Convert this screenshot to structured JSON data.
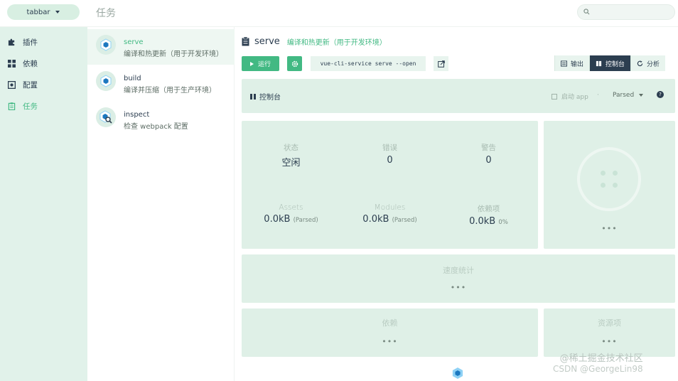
{
  "header": {
    "project_name": "tabbar",
    "page_title": "任务",
    "search_placeholder": ""
  },
  "sidebar": {
    "items": [
      {
        "label": "插件",
        "icon": "puzzle-icon",
        "active": false
      },
      {
        "label": "依赖",
        "icon": "grid-icon",
        "active": false
      },
      {
        "label": "配置",
        "icon": "settings-box-icon",
        "active": false
      },
      {
        "label": "任务",
        "icon": "clipboard-icon",
        "active": true
      }
    ]
  },
  "tasks": [
    {
      "name": "serve",
      "description": "编译和热更新（用于开发环境）",
      "icon": "webpack-cube-icon",
      "active": true
    },
    {
      "name": "build",
      "description": "编译并压缩（用于生产环境）",
      "icon": "webpack-cube-icon",
      "active": false
    },
    {
      "name": "inspect",
      "description": "检查 webpack 配置",
      "icon": "webpack-inspect-icon",
      "active": false
    }
  ],
  "task_detail": {
    "name": "serve",
    "description": "编译和热更新（用于开发环境）",
    "run_label": "运行",
    "command": "vue-cli-service serve --open",
    "view_tabs": [
      {
        "label": "输出",
        "icon": "terminal-icon",
        "active": false
      },
      {
        "label": "控制台",
        "icon": "dashboard-icon",
        "active": true
      },
      {
        "label": "分析",
        "icon": "refresh-icon",
        "active": false
      }
    ]
  },
  "console": {
    "title": "控制台",
    "start_app": "启动 app",
    "separator": "·",
    "mode": "Parsed",
    "help": "?"
  },
  "stats": {
    "status_label": "状态",
    "status_value": "空闲",
    "errors_label": "错误",
    "errors_value": "0",
    "warnings_label": "警告",
    "warnings_value": "0",
    "assets_label": "Assets",
    "assets_value": "0.0kB",
    "assets_sub": "(Parsed)",
    "modules_label": "Modules",
    "modules_value": "0.0kB",
    "modules_sub": "(Parsed)",
    "deps_label": "依赖项",
    "deps_value": "0.0kB",
    "deps_sub": "0%"
  },
  "panels": {
    "gauge_ellipsis": "•••",
    "speed_title": "速度统计",
    "speed_ellipsis": "•••",
    "deps_title": "依赖",
    "deps_ellipsis": "•••",
    "assets_title": "资源项",
    "assets_ellipsis": "•••"
  },
  "watermark": {
    "line1": "@稀土掘金技术社区",
    "line2": "CSDN @GeorgeLin98"
  },
  "colors": {
    "accent": "#42b983",
    "dark": "#2c3e50",
    "panel": "#dff0e7",
    "sidebar": "#e1f2ea"
  }
}
